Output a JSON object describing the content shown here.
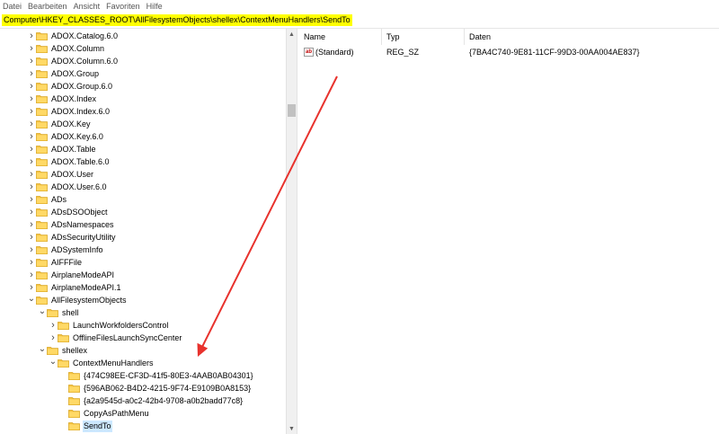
{
  "menubar": {
    "items": [
      "Datei",
      "Bearbeiten",
      "Ansicht",
      "Favoriten",
      "Hilfe"
    ]
  },
  "address": {
    "path": "Computer\\HKEY_CLASSES_ROOT\\AllFilesystemObjects\\shellex\\ContextMenuHandlers\\SendTo"
  },
  "tree": {
    "nodes": [
      {
        "label": "ADOX.Catalog.6.0",
        "expander": "collapsed"
      },
      {
        "label": "ADOX.Column",
        "expander": "collapsed"
      },
      {
        "label": "ADOX.Column.6.0",
        "expander": "collapsed"
      },
      {
        "label": "ADOX.Group",
        "expander": "collapsed"
      },
      {
        "label": "ADOX.Group.6.0",
        "expander": "collapsed"
      },
      {
        "label": "ADOX.Index",
        "expander": "collapsed"
      },
      {
        "label": "ADOX.Index.6.0",
        "expander": "collapsed"
      },
      {
        "label": "ADOX.Key",
        "expander": "collapsed"
      },
      {
        "label": "ADOX.Key.6.0",
        "expander": "collapsed"
      },
      {
        "label": "ADOX.Table",
        "expander": "collapsed"
      },
      {
        "label": "ADOX.Table.6.0",
        "expander": "collapsed"
      },
      {
        "label": "ADOX.User",
        "expander": "collapsed"
      },
      {
        "label": "ADOX.User.6.0",
        "expander": "collapsed"
      },
      {
        "label": "ADs",
        "expander": "collapsed"
      },
      {
        "label": "ADsDSOObject",
        "expander": "collapsed"
      },
      {
        "label": "ADsNamespaces",
        "expander": "collapsed"
      },
      {
        "label": "ADsSecurityUtility",
        "expander": "collapsed"
      },
      {
        "label": "ADSystemInfo",
        "expander": "collapsed"
      },
      {
        "label": "AIFFFile",
        "expander": "collapsed"
      },
      {
        "label": "AirplaneModeAPI",
        "expander": "collapsed"
      },
      {
        "label": "AirplaneModeAPI.1",
        "expander": "collapsed"
      },
      {
        "label": "AllFilesystemObjects",
        "expander": "expanded"
      },
      {
        "label": "shell",
        "expander": "expanded"
      },
      {
        "label": "LaunchWorkfoldersControl",
        "expander": "collapsed"
      },
      {
        "label": "OfflineFilesLaunchSyncCenter",
        "expander": "collapsed"
      },
      {
        "label": "shellex",
        "expander": "expanded"
      },
      {
        "label": "ContextMenuHandlers",
        "expander": "expanded"
      },
      {
        "label": "{474C98EE-CF3D-41f5-80E3-4AAB0AB04301}",
        "expander": "none"
      },
      {
        "label": "{596AB062-B4D2-4215-9F74-E9109B0A8153}",
        "expander": "none"
      },
      {
        "label": "{a2a9545d-a0c2-42b4-9708-a0b2badd77c8}",
        "expander": "none"
      },
      {
        "label": "CopyAsPathMenu",
        "expander": "none"
      },
      {
        "label": "SendTo",
        "expander": "none",
        "selected": true
      }
    ]
  },
  "list": {
    "columns": [
      "Name",
      "Typ",
      "Daten"
    ],
    "rows": [
      {
        "name": "(Standard)",
        "type": "REG_SZ",
        "data": "{7BA4C740-9E81-11CF-99D3-00AA004AE837}",
        "icon": "string-value-icon"
      }
    ]
  },
  "colors": {
    "address_highlight": "#ffff00",
    "annotation_arrow": "#e8322d",
    "folder": "#f5c342",
    "selection": "#cce8ff"
  }
}
